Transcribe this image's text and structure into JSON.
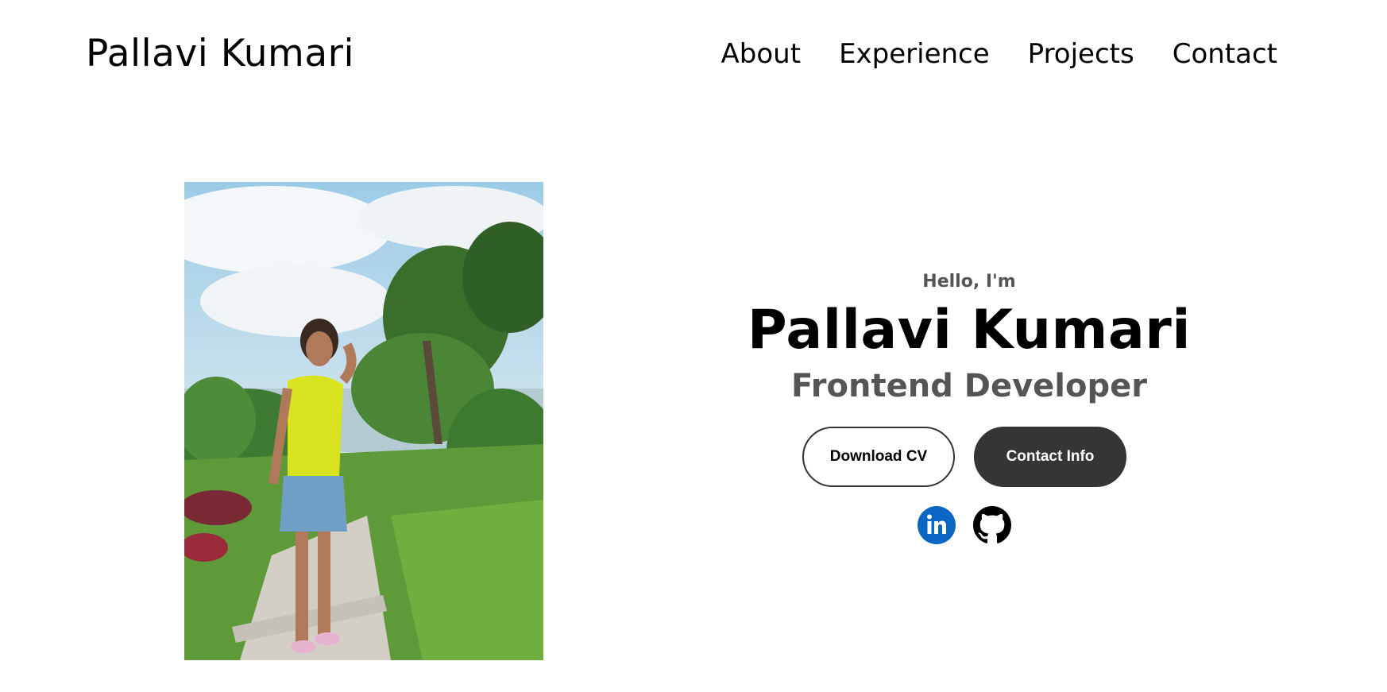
{
  "header": {
    "logo": "Pallavi Kumari",
    "nav": [
      "About",
      "Experience",
      "Projects",
      "Contact"
    ]
  },
  "hero": {
    "greeting": "Hello, I'm",
    "name": "Pallavi Kumari",
    "title": "Frontend Developer",
    "buttons": {
      "download": "Download CV",
      "contact": "Contact Info"
    },
    "socials": [
      "linkedin-icon",
      "github-icon"
    ]
  },
  "colors": {
    "text": "#000000",
    "muted": "#555555",
    "button_dark": "#353535",
    "linkedin": "#0A66C2"
  }
}
